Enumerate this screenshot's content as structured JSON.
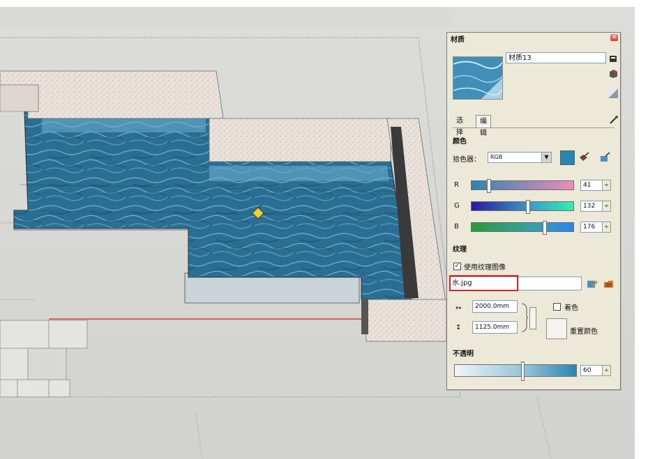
{
  "panel": {
    "title": "材质",
    "material_name": "材质13",
    "tabs": [
      "选择",
      "编辑"
    ],
    "active_tab": "编辑",
    "color_section": "颜色",
    "picker_label": "拾色器：",
    "picker_value": "RGB",
    "swatch_color": "#2984b0",
    "channels": [
      {
        "label": "R",
        "value": 41
      },
      {
        "label": "G",
        "value": 132
      },
      {
        "label": "B",
        "value": 176
      }
    ],
    "texture_section": "纹理",
    "use_texture_label": "使用纹理图像",
    "use_texture_checked": true,
    "texture_file": "水.jpg",
    "width_value": "2000.0mm",
    "height_value": "1125.0mm",
    "colorize_label": "着色",
    "colorize_checked": false,
    "reset_label": "重置颜色",
    "opacity_section": "不透明",
    "opacity_value": 60
  }
}
